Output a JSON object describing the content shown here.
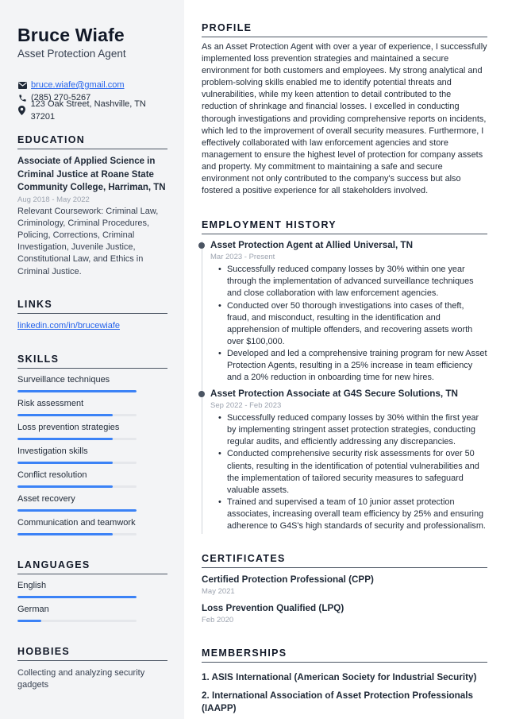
{
  "header": {
    "name": "Bruce Wiafe",
    "role": "Asset Protection Agent"
  },
  "contacts": {
    "email": "bruce.wiafe@gmail.com",
    "phone": "(285) 270-5267",
    "address": "123 Oak Street, Nashville, TN 37201",
    "icons": [
      "envelope-icon",
      "phone-icon",
      "map-pin-icon"
    ]
  },
  "education": {
    "title": "EDUCATION",
    "degree": "Associate of Applied Science in Criminal Justice at Roane State Community College, Harriman, TN",
    "dates": "Aug 2018 - May 2022",
    "description": "Relevant Coursework: Criminal Law, Criminology, Criminal Procedures, Policing, Corrections, Criminal Investigation, Juvenile Justice, Constitutional Law, and Ethics in Criminal Justice."
  },
  "links": {
    "title": "LINKS",
    "items": [
      "linkedin.com/in/brucewiafe"
    ]
  },
  "skills": {
    "title": "SKILLS",
    "items": [
      {
        "label": "Surveillance techniques",
        "level": 100
      },
      {
        "label": "Risk assessment",
        "level": 80
      },
      {
        "label": "Loss prevention strategies",
        "level": 80
      },
      {
        "label": "Investigation skills",
        "level": 80
      },
      {
        "label": "Conflict resolution",
        "level": 80
      },
      {
        "label": "Asset recovery",
        "level": 100
      },
      {
        "label": "Communication and teamwork",
        "level": 80
      }
    ]
  },
  "languages": {
    "title": "LANGUAGES",
    "items": [
      {
        "label": "English",
        "level": 100
      },
      {
        "label": "German",
        "level": 20
      }
    ]
  },
  "hobbies": {
    "title": "HOBBIES",
    "items": [
      "Collecting and analyzing security gadgets"
    ]
  },
  "profile": {
    "title": "PROFILE",
    "text": "As an Asset Protection Agent with over a year of experience, I successfully implemented loss prevention strategies and maintained a secure environment for both customers and employees. My strong analytical and problem-solving skills enabled me to identify potential threats and vulnerabilities, while my keen attention to detail contributed to the reduction of shrinkage and financial losses. I excelled in conducting thorough investigations and providing comprehensive reports on incidents, which led to the improvement of overall security measures. Furthermore, I effectively collaborated with law enforcement agencies and store management to ensure the highest level of protection for company assets and property. My commitment to maintaining a safe and secure environment not only contributed to the company's success but also fostered a positive experience for all stakeholders involved."
  },
  "employment": {
    "title": "EMPLOYMENT HISTORY",
    "jobs": [
      {
        "title": "Asset Protection Agent at Allied Universal, TN",
        "dates": "Mar 2023 - Present",
        "bullets": [
          "Successfully reduced company losses by 30% within one year through the implementation of advanced surveillance techniques and close collaboration with law enforcement agencies.",
          "Conducted over 50 thorough investigations into cases of theft, fraud, and misconduct, resulting in the identification and apprehension of multiple offenders, and recovering assets worth over $100,000.",
          "Developed and led a comprehensive training program for new Asset Protection Agents, resulting in a 25% increase in team efficiency and a 20% reduction in onboarding time for new hires."
        ]
      },
      {
        "title": "Asset Protection Associate at G4S Secure Solutions, TN",
        "dates": "Sep 2022 - Feb 2023",
        "bullets": [
          "Successfully reduced company losses by 30% within the first year by implementing stringent asset protection strategies, conducting regular audits, and efficiently addressing any discrepancies.",
          "Conducted comprehensive security risk assessments for over 50 clients, resulting in the identification of potential vulnerabilities and the implementation of tailored security measures to safeguard valuable assets.",
          "Trained and supervised a team of 10 junior asset protection associates, increasing overall team efficiency by 25% and ensuring adherence to G4S's high standards of security and professionalism."
        ]
      }
    ]
  },
  "certificates": {
    "title": "CERTIFICATES",
    "items": [
      {
        "title": "Certified Protection Professional (CPP)",
        "date": "May 2021"
      },
      {
        "title": "Loss Prevention Qualified (LPQ)",
        "date": "Feb 2020"
      }
    ]
  },
  "memberships": {
    "title": "MEMBERSHIPS",
    "items": [
      "1. ASIS International (American Society for Industrial Security)",
      "2. International Association of Asset Protection Professionals (IAAPP)"
    ]
  },
  "colors": {
    "accent": "#3b82f6",
    "link": "#2563eb",
    "sidebar_bg": "#f3f4f6",
    "bar_track": "#e5e7eb"
  }
}
